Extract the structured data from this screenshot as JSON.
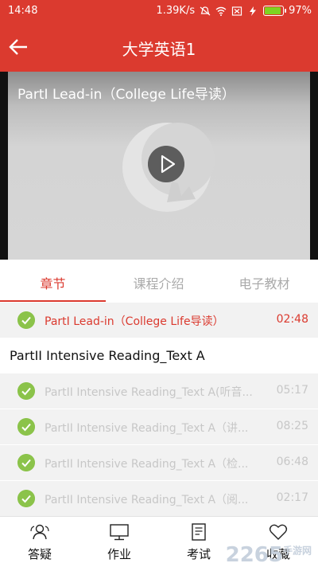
{
  "status_bar": {
    "time": "14:48",
    "speed": "1.39K/s",
    "battery": "97%"
  },
  "header": {
    "title": "大学英语1"
  },
  "video": {
    "title": "PartI Lead-in（College Life导读）"
  },
  "tabs": [
    {
      "label": "章节"
    },
    {
      "label": "课程介绍"
    },
    {
      "label": "电子教材"
    }
  ],
  "chapter_list": {
    "current": {
      "title": "PartI Lead-in（College Life导读）",
      "duration": "02:48"
    },
    "section_title": "PartII Intensive Reading_Text A",
    "items": [
      {
        "title": "PartII Intensive Reading_Text A(听音...",
        "duration": "05:17"
      },
      {
        "title": "PartII Intensive Reading_Text A（讲...",
        "duration": "08:25"
      },
      {
        "title": "PartII Intensive Reading_Text A（检...",
        "duration": "06:48"
      },
      {
        "title": "PartII Intensive Reading_Text A（阅...",
        "duration": "02:17"
      }
    ]
  },
  "bottom_nav": [
    {
      "label": "答疑",
      "icon": "qa-icon"
    },
    {
      "label": "作业",
      "icon": "monitor-icon"
    },
    {
      "label": "考试",
      "icon": "document-icon"
    },
    {
      "label": "收藏",
      "icon": "heart-icon"
    }
  ],
  "watermark": {
    "text": "2265",
    "suffix": "手游网"
  },
  "colors": {
    "accent": "#db3a2f",
    "check": "#8bc34a",
    "battery": "#7ed321"
  }
}
